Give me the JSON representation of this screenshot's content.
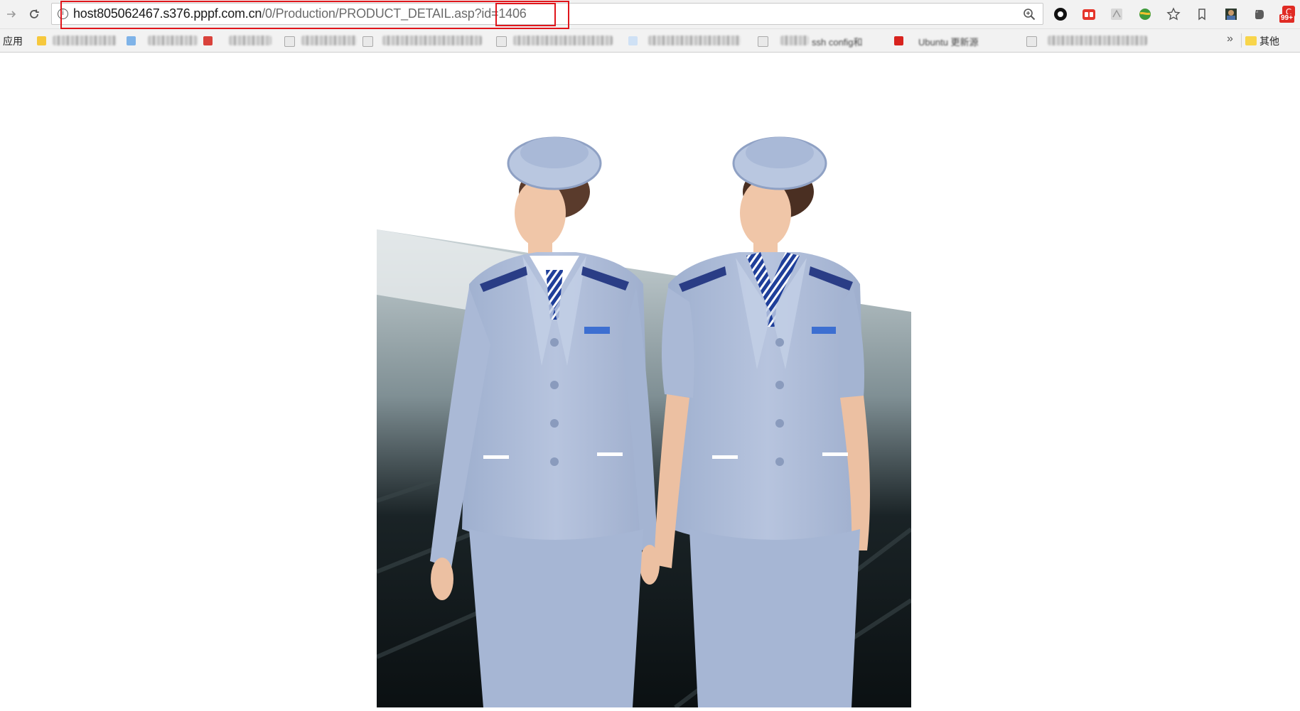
{
  "browser": {
    "url": {
      "host": "host805062467.s376.pppf.com.cn",
      "path": "/0/Production/PRODUCT_DETAIL.asp",
      "query": "?id=1406"
    },
    "notification_badge": "99+"
  },
  "bookmarks": {
    "apps_label": "应用",
    "more_label": "»",
    "other_label": "其他",
    "visible_fragments": [
      "ssh config和",
      "Ubuntu 更新源"
    ]
  },
  "colors": {
    "highlight": "#e0151b",
    "uniform": "#aebbd6",
    "background": "#ffffff"
  },
  "image": {
    "subject": "two women in light blue flight-attendant uniforms with hats and striped ties"
  }
}
